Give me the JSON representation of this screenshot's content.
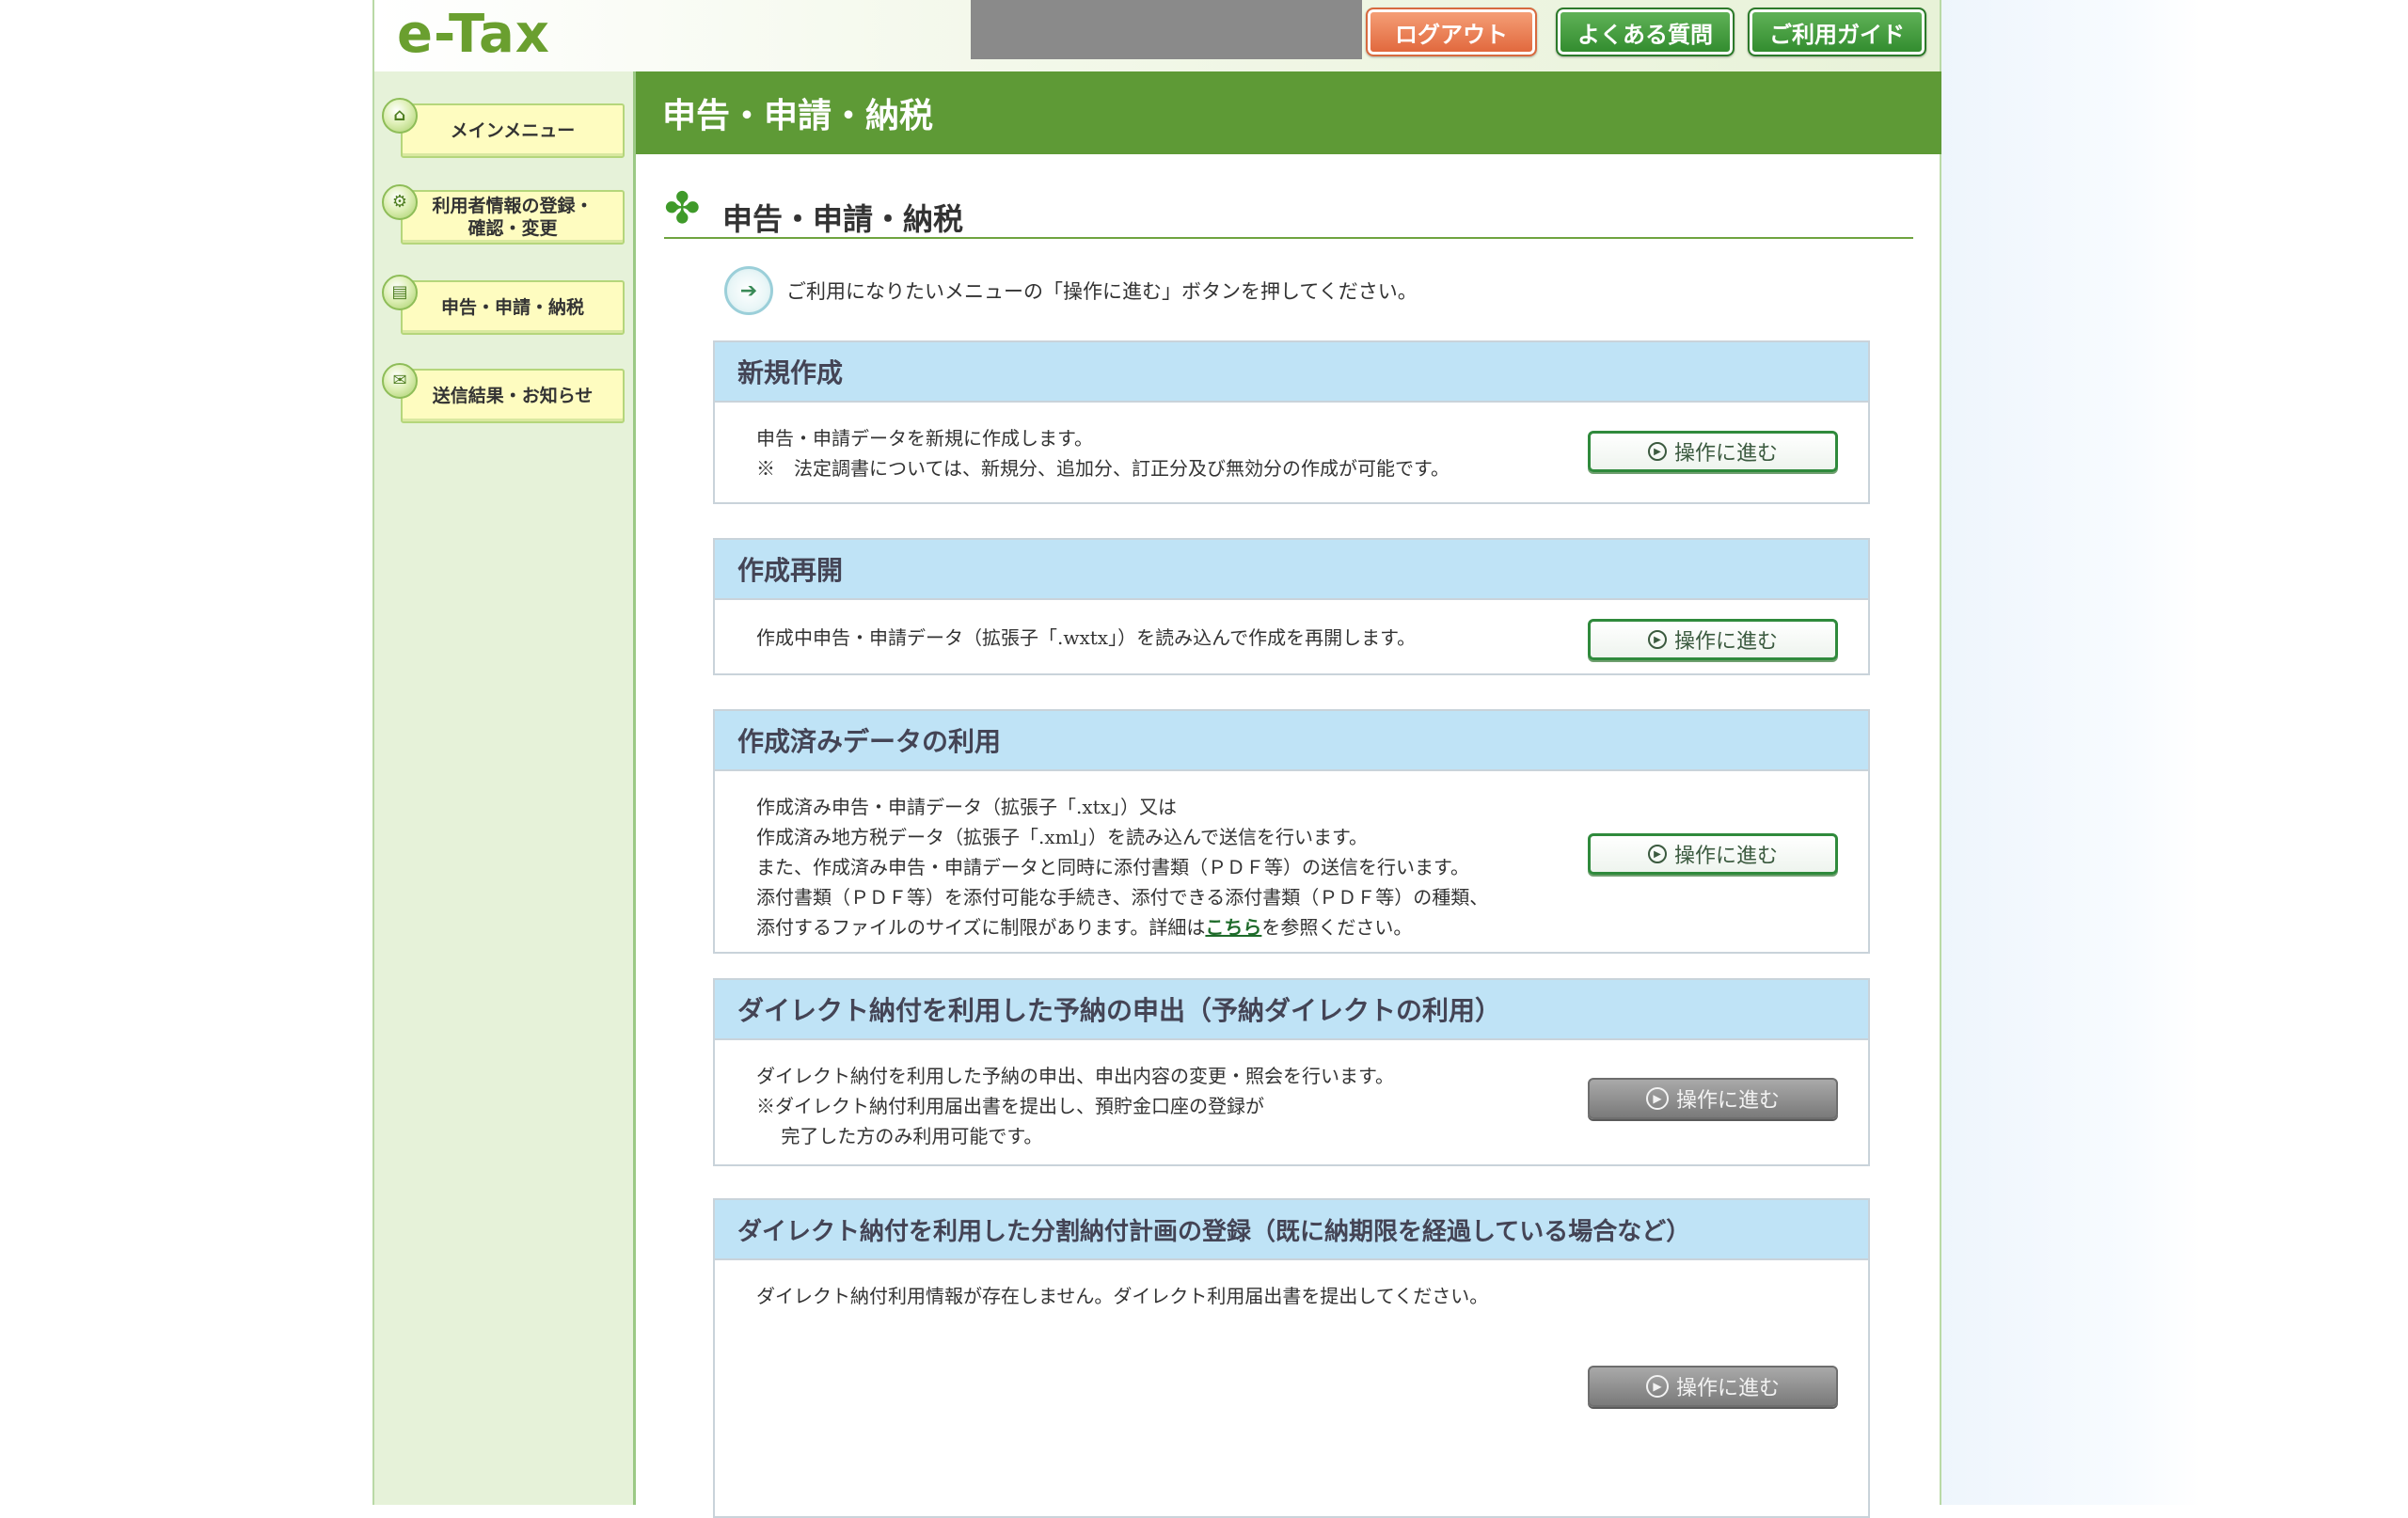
{
  "header": {
    "logo": "e-Tax",
    "logout": "ログアウト",
    "faq": "よくある質問",
    "guide": "ご利用ガイド"
  },
  "sidebar": {
    "items": [
      {
        "label": "メインメニュー",
        "icon": "home-icon"
      },
      {
        "label": "利用者情報の登録・\n確認・変更",
        "icon": "gear-icon"
      },
      {
        "label": "申告・申請・納税",
        "icon": "document-icon"
      },
      {
        "label": "送信結果・お知らせ",
        "icon": "mail-icon"
      }
    ]
  },
  "main": {
    "title": "申告・申請・納税",
    "subtitle": "申告・申請・納税",
    "instruction": "ご利用になりたいメニューの「操作に進む」ボタンを押してください。",
    "sections": [
      {
        "title": "新規作成",
        "lines": [
          "申告・申請データを新規に作成します。",
          "※　法定調書については、新規分、追加分、訂正分及び無効分の作成が可能です。"
        ],
        "button": "操作に進む",
        "enabled": true
      },
      {
        "title": "作成再開",
        "lines": [
          "作成中申告・申請データ（拡張子「.wxtx」）を読み込んで作成を再開します。"
        ],
        "button": "操作に進む",
        "enabled": true
      },
      {
        "title": "作成済みデータの利用",
        "lines": [
          "作成済み申告・申請データ（拡張子「.xtx」）又は",
          "作成済み地方税データ（拡張子「.xml」）を読み込んで送信を行います。",
          "また、作成済み申告・申請データと同時に添付書類（ＰＤＦ等）の送信を行います。",
          "添付書類（ＰＤＦ等）を添付可能な手続き、添付できる添付書類（ＰＤＦ等）の種類、"
        ],
        "last_line_pre": "添付するファイルのサイズに制限があります。詳細は",
        "last_line_link": "こちら",
        "last_line_post": "を参照ください。",
        "button": "操作に進む",
        "enabled": true
      },
      {
        "title": "ダイレクト納付を利用した予納の申出（予納ダイレクトの利用）",
        "lines": [
          "ダイレクト納付を利用した予納の申出、申出内容の変更・照会を行います。",
          "※ダイレクト納付利用届出書を提出し、預貯金口座の登録が",
          "　 完了した方のみ利用可能です。"
        ],
        "button": "操作に進む",
        "enabled": false
      },
      {
        "title": "ダイレクト納付を利用した分割納付計画の登録（既に納期限を経過している場合など）",
        "lines": [
          "ダイレクト納付利用情報が存在しません。ダイレクト利用届出書を提出してください。"
        ],
        "button": "操作に進む",
        "enabled": false
      }
    ]
  },
  "colors": {
    "brand_green": "#5e9a36",
    "section_header": "#bfe3f6",
    "sidebar_bg": "#e6f2d9",
    "logout_orange": "#e0653a"
  }
}
